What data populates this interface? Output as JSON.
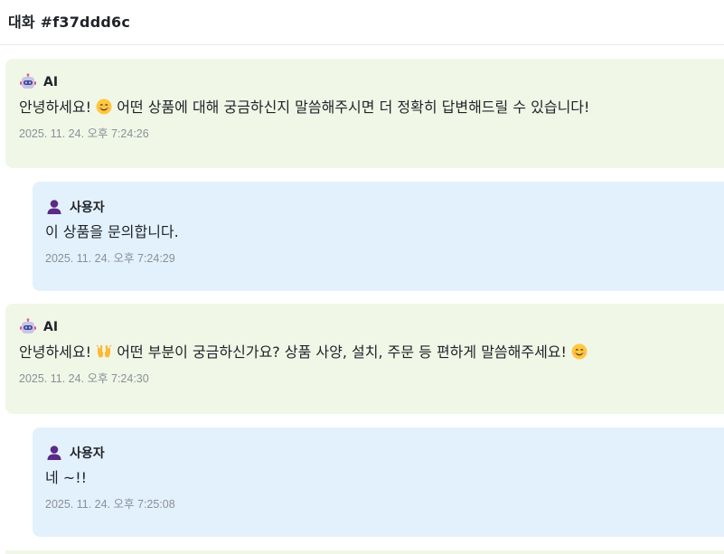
{
  "header": {
    "title": "대화 #f37ddd6c"
  },
  "messages": [
    {
      "role": "ai",
      "sender": "AI",
      "icon": "robot-icon",
      "text_before": "안녕하세요! ",
      "emoji": "smiling-face-icon",
      "text_after": " 어떤 상품에 대해 궁금하신지 말씀해주시면 더 정확히 답변해드릴 수 있습니다!",
      "timestamp": "2025. 11. 24. 오후 7:24:26"
    },
    {
      "role": "user",
      "sender": "사용자",
      "icon": "user-icon",
      "text": "이 상품을 문의합니다.",
      "timestamp": "2025. 11. 24. 오후 7:24:29"
    },
    {
      "role": "ai",
      "sender": "AI",
      "icon": "robot-icon",
      "text_before": "안녕하세요! ",
      "emoji": "raising-hands-icon",
      "text_middle": " 어떤 부분이 궁금하신가요? 상품 사양, 설치, 주문 등 편하게 말씀해주세요! ",
      "emoji2": "smiling-face-icon",
      "timestamp": "2025. 11. 24. 오후 7:24:30"
    },
    {
      "role": "user",
      "sender": "사용자",
      "icon": "user-icon",
      "text": "네 ~!!",
      "timestamp": "2025. 11. 24. 오후 7:25:08"
    }
  ],
  "colors": {
    "ai_bubble": "#f0f7e7",
    "user_bubble": "#e3f1fd",
    "timestamp": "#8a9096",
    "user_icon": "#5b2a86"
  }
}
